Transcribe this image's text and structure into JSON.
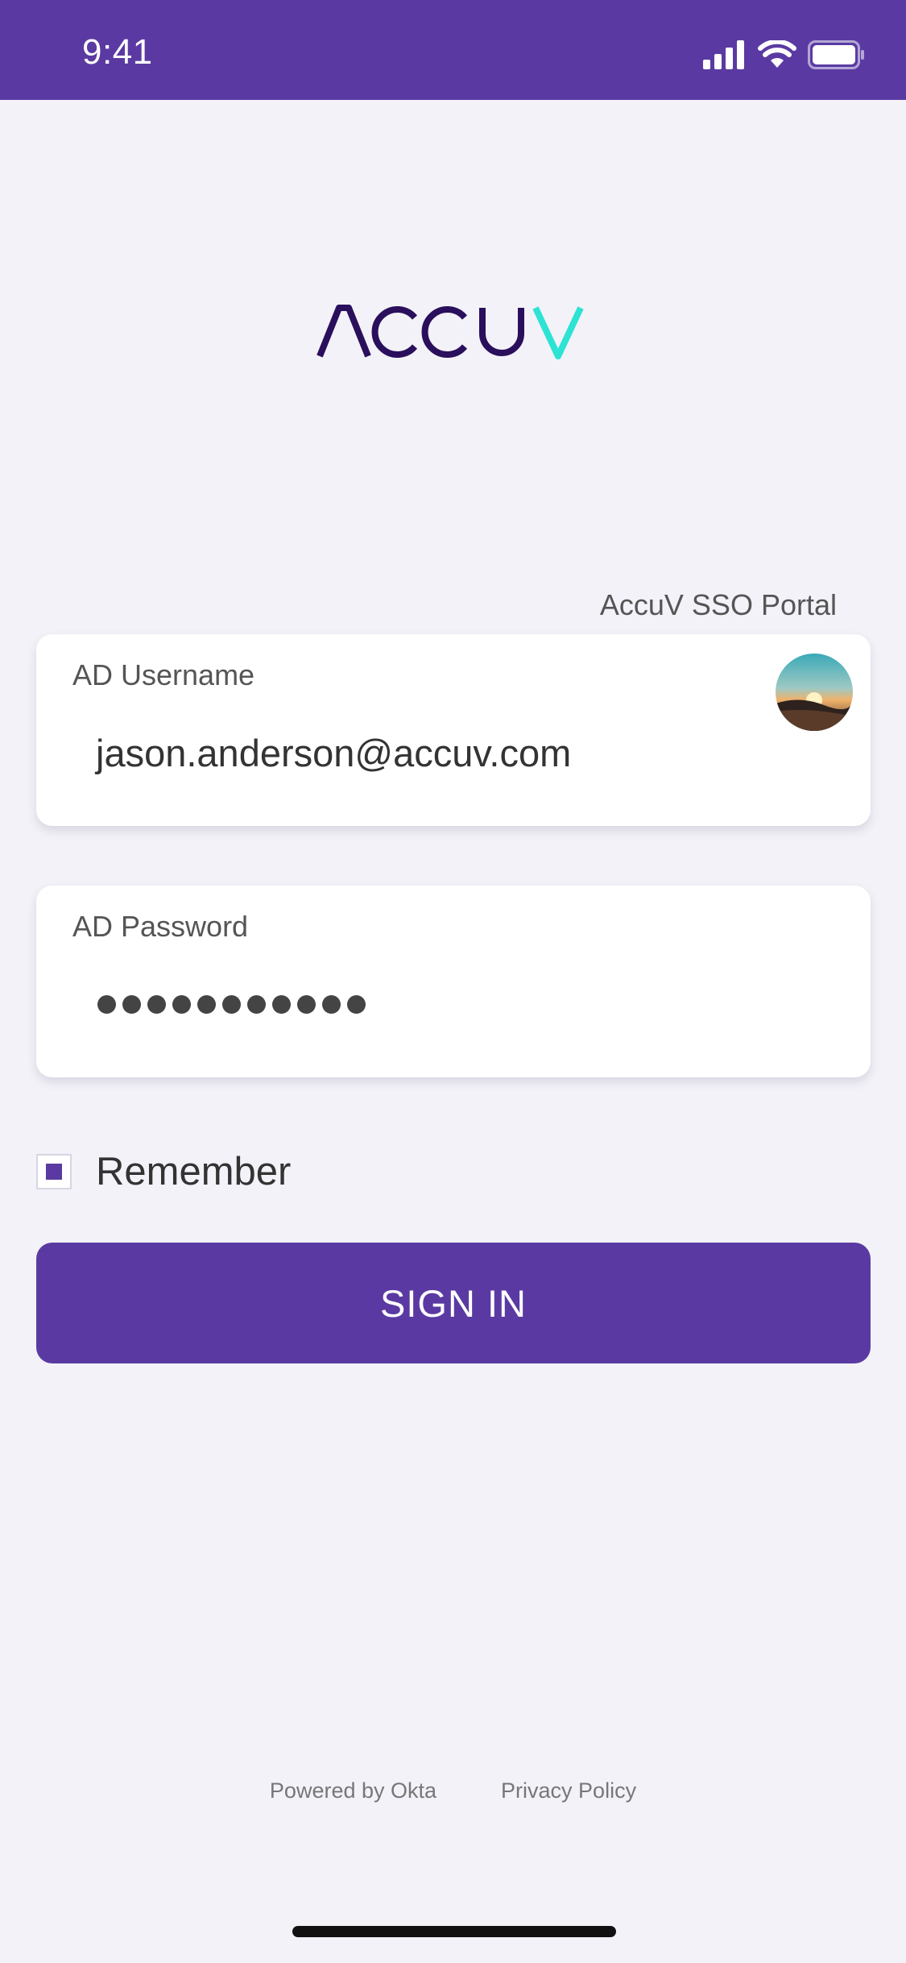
{
  "status_bar": {
    "time": "9:41",
    "icons": [
      "signal-icon",
      "wifi-icon",
      "battery-icon"
    ],
    "background": "#5a3aa2"
  },
  "brand": {
    "logo_text": "ACCUV",
    "primary_color": "#2a0f5c",
    "accent_color": "#2de3d3"
  },
  "login": {
    "portal_label": "AccuV SSO Portal",
    "username": {
      "label": "AD Username",
      "value": "jason.anderson@accuv.com"
    },
    "password": {
      "label": "AD Password",
      "masked_length": 11
    },
    "remember": {
      "label": "Remember",
      "checked": true
    },
    "sign_in_label": "SIGN IN",
    "accent": "#5a3aa2"
  },
  "footer": {
    "powered_by": "Powered by Okta",
    "privacy": "Privacy Policy"
  }
}
